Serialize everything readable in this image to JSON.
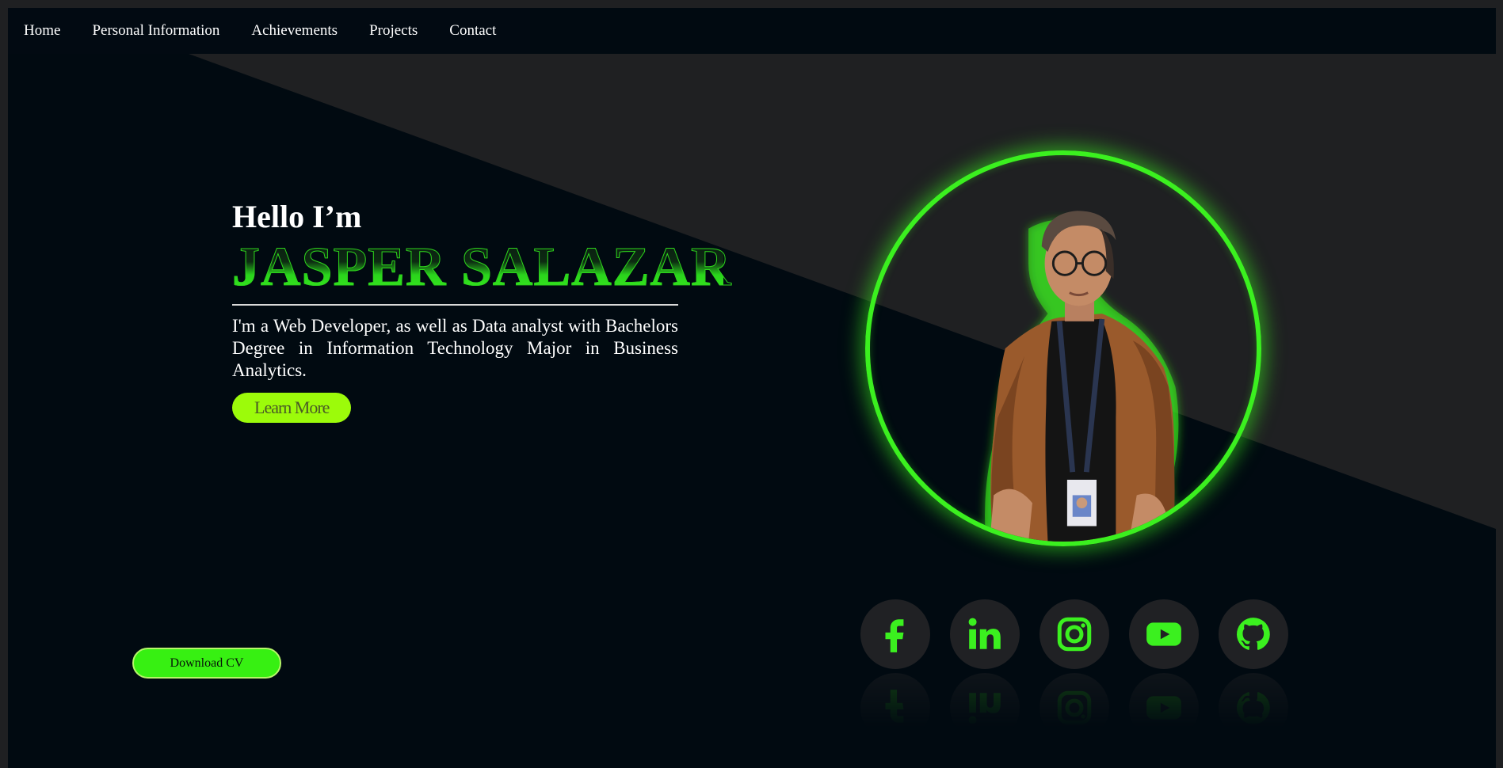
{
  "nav": {
    "items": [
      {
        "label": "Home"
      },
      {
        "label": "Personal Information"
      },
      {
        "label": "Achievements"
      },
      {
        "label": "Projects"
      },
      {
        "label": "Contact"
      }
    ]
  },
  "hero": {
    "greeting": "Hello I’m",
    "name": "JASPER SALAZAR",
    "bio": "I'm a Web Developer, as well as Data analyst with Bachelors Degree in Information Technology Major in Business Analytics.",
    "learn_more_label": "Learn More"
  },
  "download_cv_label": "Download CV",
  "socials": [
    {
      "icon": "facebook-icon"
    },
    {
      "icon": "linkedin-icon"
    },
    {
      "icon": "instagram-icon"
    },
    {
      "icon": "youtube-icon"
    },
    {
      "icon": "github-icon"
    }
  ],
  "colors": {
    "accent_green": "#3bf01f",
    "lime_button": "#9cfb0a",
    "background_dark": "#010a11",
    "background_gray": "#1f2022"
  }
}
